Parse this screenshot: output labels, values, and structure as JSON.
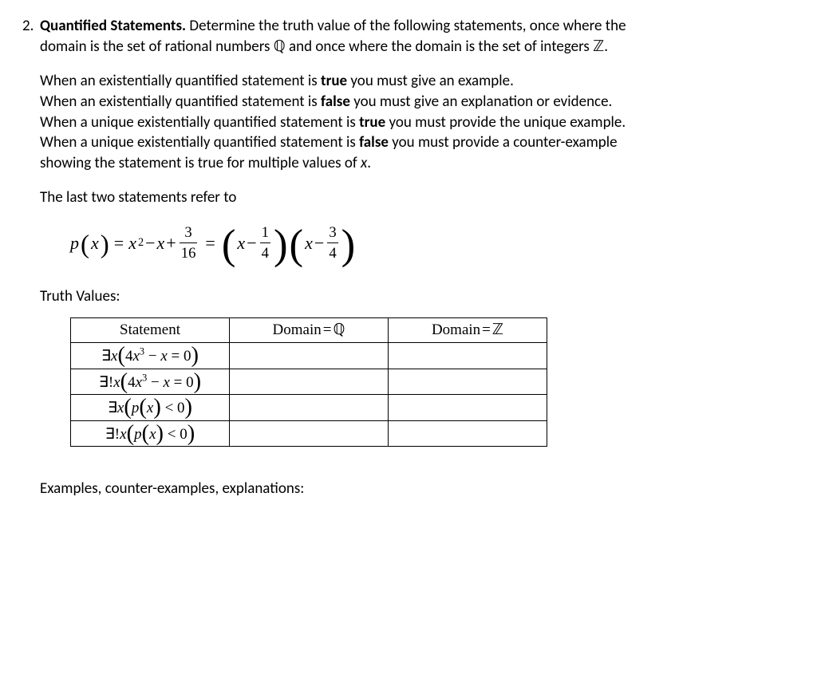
{
  "problem": {
    "number": "2.",
    "heading": "Quantified Statements.",
    "intro_a": " Determine the truth value of the following statements, once where the",
    "intro_b": "domain is the set of rational numbers ",
    "Q": "ℚ",
    "intro_c": "  and once where the domain is the set of integers ",
    "Z": "ℤ",
    "period": "."
  },
  "instructions": {
    "l1a": "When an existentially quantified statement is ",
    "l1b": "true",
    "l1c": " you must give an example.",
    "l2a": "When an existentially quantified statement is ",
    "l2b": "false",
    "l2c": " you must give an explanation or evidence.",
    "l3a": "When a unique existentially quantified statement is ",
    "l3b": "true",
    "l3c": " you must provide the unique example.",
    "l4a": "When a unique existentially quantified statement is ",
    "l4b": "false",
    "l4c": " you must provide a counter-example",
    "l5": "showing the statement is true for multiple values of ",
    "l5x": "x",
    "l5d": "."
  },
  "refer": "The last two statements refer to",
  "pxdef": {
    "lhs_p": "p",
    "lhs_open": "(",
    "lhs_x": "x",
    "lhs_close": ")",
    "eq1": "=",
    "x2_x": "x",
    "x2_sup": "2",
    "minus1": " − ",
    "x_term": "x",
    "plus": " + ",
    "frac3": "3",
    "frac16": "16",
    "eq2": "=",
    "po1_x": "x",
    "po1_minus": " − ",
    "po1_num": "1",
    "po1_den": "4",
    "po2_x": "x",
    "po2_minus": " − ",
    "po2_num": "3",
    "po2_den": "4"
  },
  "truth_label": "Truth Values:",
  "table": {
    "head_stmt": "Statement",
    "head_Q_a": "Domain",
    "head_Q_eq": "=",
    "head_Q": "ℚ",
    "head_Z_a": "Domain",
    "head_Z_eq": "=",
    "head_Z": "ℤ",
    "rows": {
      "r1": {
        "exists": "∃",
        "x": "x",
        "o": "(",
        "n4": "4",
        "xv": "x",
        "sup": "3",
        "m": " − ",
        "xv2": "x",
        "eq": " = ",
        "z": "0",
        "c": ")"
      },
      "r2": {
        "exists": "∃!",
        "x": "x",
        "o": "(",
        "n4": "4",
        "xv": "x",
        "sup": "3",
        "m": " − ",
        "xv2": "x",
        "eq": " = ",
        "z": "0",
        "c": ")"
      },
      "r3": {
        "exists": "∃",
        "x": "x",
        "o": "(",
        "p": "p",
        "po": "(",
        "xv": "x",
        "pc": ")",
        "lt": " < ",
        "z": "0",
        "c": ")"
      },
      "r4": {
        "exists": "∃!",
        "x": "x",
        "o": "(",
        "p": "p",
        "po": "(",
        "xv": "x",
        "pc": ")",
        "lt": " < ",
        "z": "0",
        "c": ")"
      }
    }
  },
  "examples_label": "Examples, counter-examples, explanations:"
}
